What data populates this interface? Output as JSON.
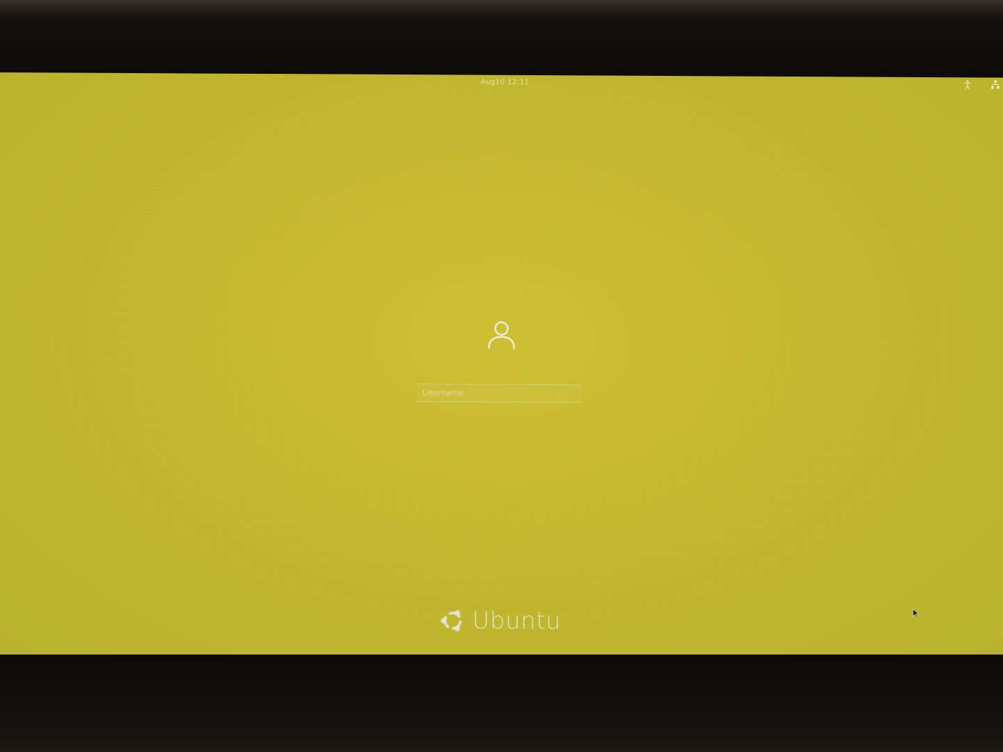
{
  "top_bar": {
    "clock": "Aug10  12:11",
    "icons": [
      "accessibility-icon",
      "network-icon"
    ]
  },
  "login": {
    "avatar_icon": "user-avatar-icon",
    "username_placeholder": "Username"
  },
  "branding": {
    "logo_icon": "ubuntu-logo-icon",
    "name": "Ubuntu"
  },
  "colors": {
    "background": "#c2b92e",
    "foreground": "#e6e8d8"
  }
}
